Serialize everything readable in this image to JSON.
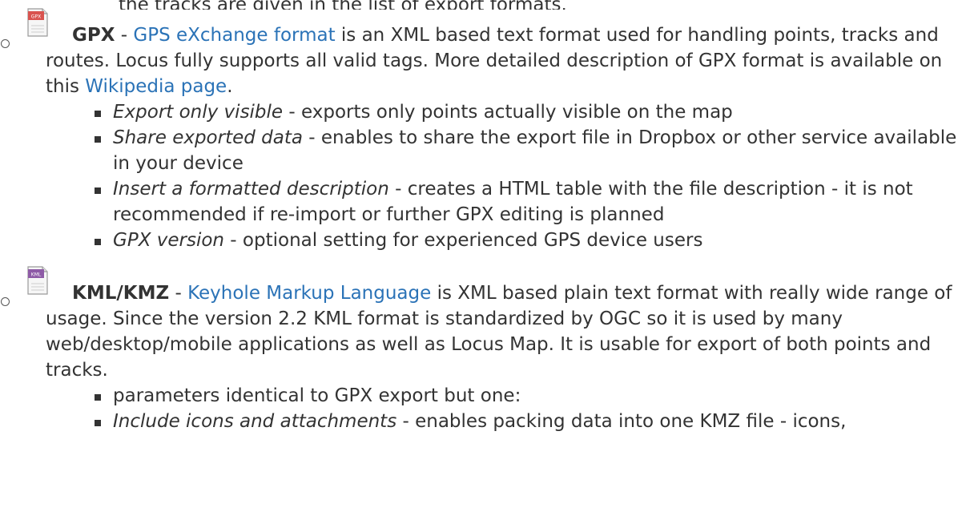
{
  "top_line": "the tracks are given in the list of export formats.",
  "formats": [
    {
      "icon": "gpx-file-icon",
      "icon_label": "GPX",
      "name": "GPX",
      "sep": " - ",
      "link": "GPS eXchange format",
      "desc_a": " is an XML based text format used for handling points, tracks and routes. Locus fully supports all valid tags. More detailed description of GPX format is available on this ",
      "link2": "Wikipedia page",
      "desc_b": ".",
      "items": [
        {
          "term": "Export only visible",
          "text": " - exports only points actually visible on the map"
        },
        {
          "term": "Share exported data",
          "text": " - enables to share the export file in Dropbox or other service available in your device"
        },
        {
          "term": "Insert a formatted description",
          "text": " - creates a HTML table with the file description - it is not recommended if re-import or further GPX editing is planned"
        },
        {
          "term": "GPX version",
          "text": " - optional setting for experienced GPS device users"
        }
      ]
    },
    {
      "icon": "kml-file-icon",
      "icon_label": "KML",
      "name": "KML/KMZ",
      "sep": " - ",
      "link": "Keyhole Markup Language",
      "desc_a": " is XML based plain text format with really wide range of usage. Since the version 2.2 KML format is standardized by OGC so it is used by many web/desktop/mobile applications as well as Locus Map. It is usable for export of both points and tracks.",
      "items": [
        {
          "term": "",
          "text": "parameters identical to GPX export but one:"
        },
        {
          "term": "Include icons and attachments",
          "text": " - enables packing data into one KMZ file - icons,"
        }
      ]
    }
  ],
  "colors": {
    "link": "#2b73b7",
    "text": "#333333",
    "gpx_icon": "#d9534f",
    "kml_icon": "#8e5ba6"
  }
}
